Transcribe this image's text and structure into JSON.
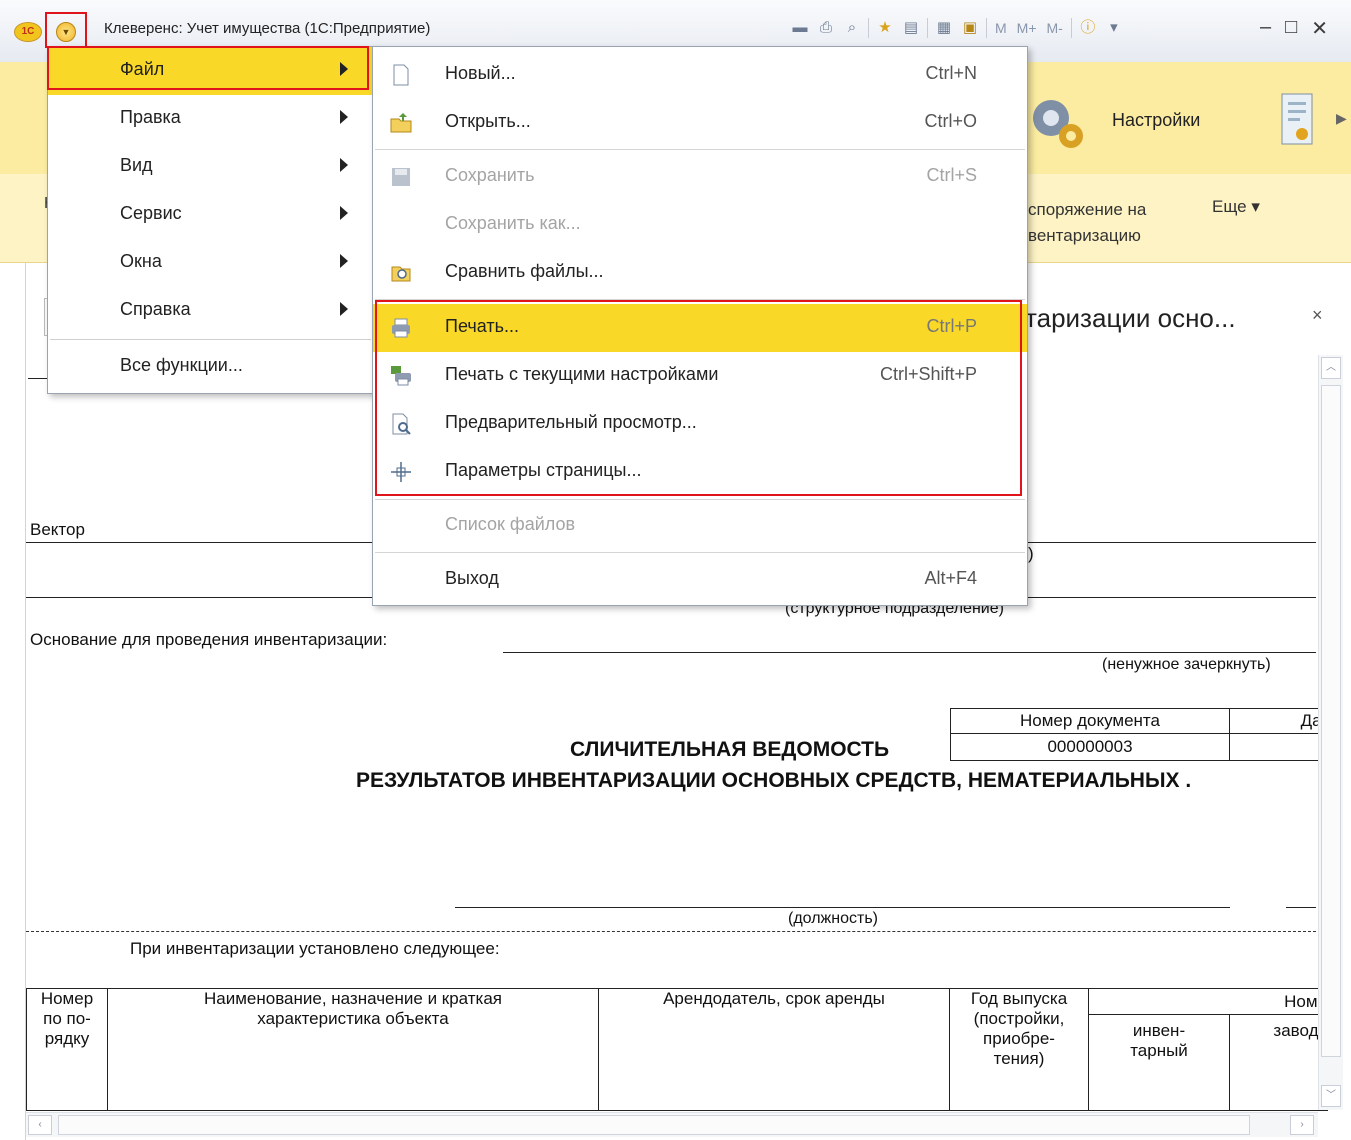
{
  "window": {
    "title": "Клеверенс: Учет имущества  (1С:Предприятие)",
    "logo_text": "1С",
    "toolbar_labels": [
      "M",
      "M+",
      "M-"
    ]
  },
  "sections": {
    "settings_label": "Настройки"
  },
  "commandbar": {
    "order_line1": "споряжение на",
    "order_line2": "вентаризацию",
    "more_label": "Еще ▾",
    "left_letter": "Н"
  },
  "form": {
    "title": "таризации осно...",
    "close_symbol": "×"
  },
  "document": {
    "org_name": "Вектор",
    "struct_caption": "(структурное подразделение)",
    "basis_label": "Основание для проведения инвентаризации:",
    "strike_caption": "(ненужное зачеркнуть)",
    "docnum_header": "Номер документа",
    "date_header": "Дат",
    "docnum_value": "000000003",
    "heading1": "СЛИЧИТЕЛЬНАЯ ВЕДОМОСТЬ",
    "heading2": "РЕЗУЛЬТАТОВ ИНВЕНТАРИЗАЦИИ ОСНОВНЫХ СРЕДСТВ, НЕМАТЕРИАЛЬНЫХ .",
    "position_caption": "(должность)",
    "established_label": "При инвентаризации установлено следующее:",
    "paren_fragment": ")",
    "columns": {
      "num": [
        "Номер",
        "по по-",
        "рядку"
      ],
      "name": [
        "Наименование, назначение и краткая",
        "характеристика объекта"
      ],
      "lessor": "Арендодатель, срок аренды",
      "year": [
        "Год выпуска",
        "(постройки,",
        "приобре-",
        "тения)"
      ],
      "numbers_header": "Номе",
      "inventory": [
        "инвен-",
        "тарный"
      ],
      "factory": "заводс"
    }
  },
  "main_menu": {
    "items": [
      {
        "label": "Файл",
        "submenu": true,
        "active": true
      },
      {
        "label": "Правка",
        "submenu": true
      },
      {
        "label": "Вид",
        "submenu": true
      },
      {
        "label": "Сервис",
        "submenu": true
      },
      {
        "label": "Окна",
        "submenu": true
      },
      {
        "label": "Справка",
        "submenu": true
      },
      {
        "label": "Все функции...",
        "submenu": false
      }
    ]
  },
  "file_menu": {
    "items": [
      {
        "label": "Новый...",
        "shortcut": "Ctrl+N",
        "icon": "new-document-icon"
      },
      {
        "label": "Открыть...",
        "shortcut": "Ctrl+O",
        "icon": "open-folder-icon"
      },
      {
        "label": "Сохранить",
        "shortcut": "Ctrl+S",
        "icon": "save-icon",
        "disabled": true
      },
      {
        "label": "Сохранить как...",
        "shortcut": "",
        "disabled": true
      },
      {
        "label": "Сравнить файлы...",
        "shortcut": "",
        "icon": "compare-files-icon"
      },
      {
        "label": "Печать...",
        "shortcut": "Ctrl+P",
        "icon": "printer-icon",
        "active": true
      },
      {
        "label": "Печать с текущими настройками",
        "shortcut": "Ctrl+Shift+P",
        "icon": "print-current-settings-icon"
      },
      {
        "label": "Предварительный просмотр...",
        "shortcut": "",
        "icon": "print-preview-icon"
      },
      {
        "label": "Параметры страницы...",
        "shortcut": "",
        "icon": "page-setup-icon"
      },
      {
        "label": "Список файлов",
        "shortcut": "",
        "disabled": true
      },
      {
        "label": "Выход",
        "shortcut": "Alt+F4"
      }
    ]
  },
  "colors": {
    "highlight": "#f9d827",
    "red_frame": "#e0141b",
    "section_bar": "#fbeca1"
  }
}
